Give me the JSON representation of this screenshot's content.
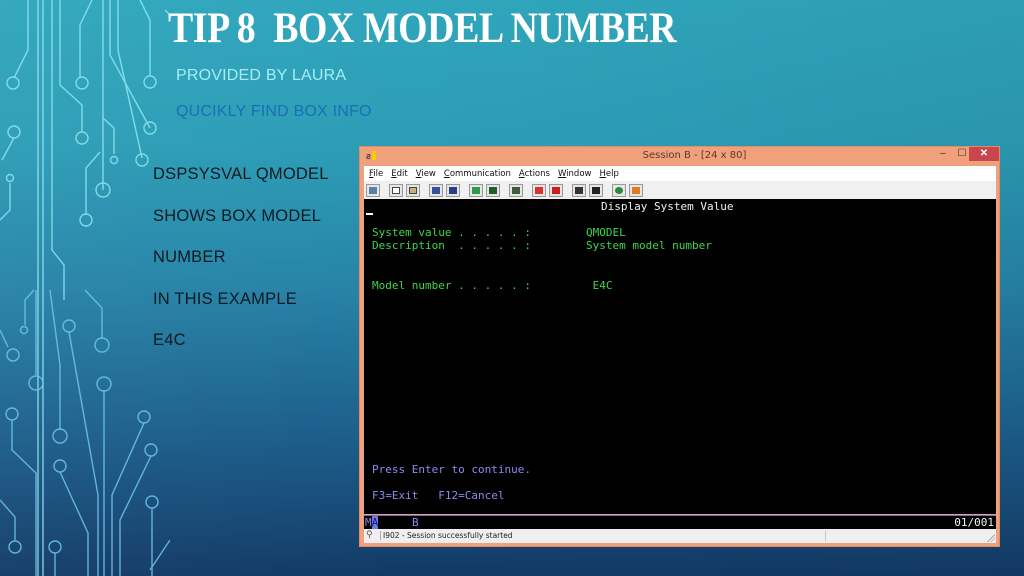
{
  "slide": {
    "title": "TIP 8  BOX MODEL NUMBER",
    "subtitle": "PROVIDED BY LAURA",
    "subtitle2": "QUCIKLY FIND BOX INFO",
    "bullets": [
      "DSPSYSVAL QMODEL",
      "SHOWS BOX MODEL",
      "NUMBER",
      "IN THIS EXAMPLE",
      "E4C"
    ]
  },
  "window": {
    "app_icon": "emulator-app-icon",
    "title": "Session B - [24 x 80]",
    "controls": {
      "minimize": "‒",
      "maximize": "☐",
      "close": "✕"
    },
    "menu": [
      "File",
      "Edit",
      "View",
      "Communication",
      "Actions",
      "Window",
      "Help"
    ],
    "toolbar_icons": [
      "print-screen-icon",
      "copy-icon",
      "paste-icon",
      "send-file-icon",
      "receive-file-icon",
      "display-keypad-icon",
      "quick-keypad-icon",
      "color-map-icon",
      "record-macro-icon",
      "stop-macro-icon",
      "play-macro-icon",
      "pause-macro-icon",
      "connect-icon",
      "customize-icon"
    ]
  },
  "terminal": {
    "screen_title": "Display System Value",
    "rows": [
      {
        "label": "System value . . . . . :",
        "value": "QMODEL"
      },
      {
        "label": "Description  . . . . . :",
        "value": "System model number"
      },
      {
        "label": "Model number . . . . . :",
        "value": " E4C"
      }
    ],
    "prompt": "Press Enter to continue.",
    "function_keys": "F3=Exit   F12=Cancel",
    "oia": {
      "mode": "MA",
      "session": "B",
      "cursor_pos": "01/001"
    }
  },
  "statusbar": {
    "message": "I902 - Session successfully started"
  }
}
